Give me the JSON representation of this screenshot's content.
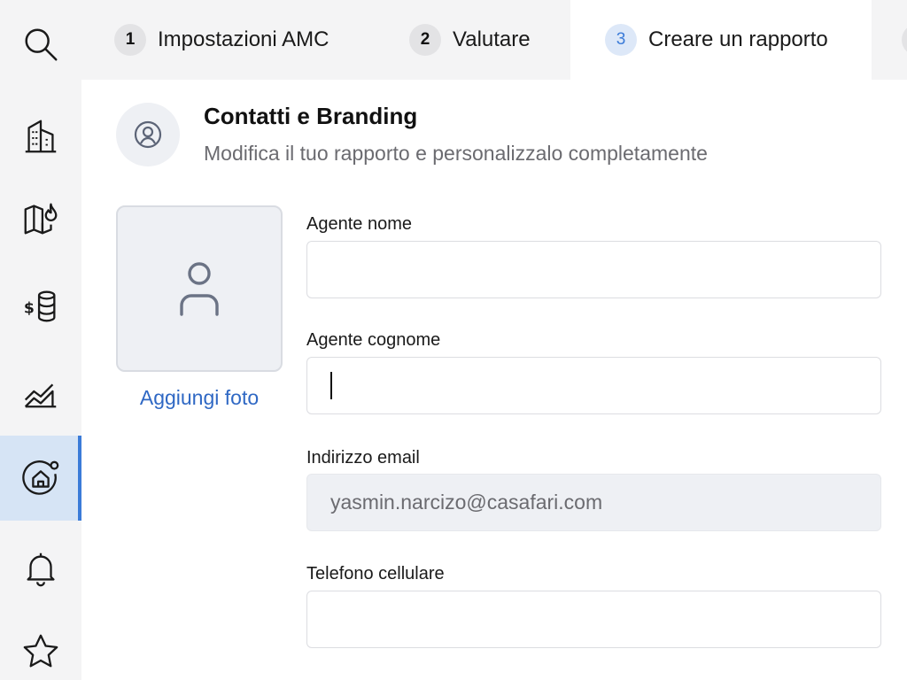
{
  "sidebar": {
    "items": [
      {
        "icon": "search-icon"
      },
      {
        "icon": "building-icon"
      },
      {
        "icon": "map-fire-icon"
      },
      {
        "icon": "dollar-database-icon"
      },
      {
        "icon": "chart-area-icon"
      },
      {
        "icon": "home-notification-icon",
        "active": true
      },
      {
        "icon": "bell-icon"
      },
      {
        "icon": "star-icon"
      }
    ],
    "accent_color": "#3b7bd8"
  },
  "tabs": [
    {
      "number": "1",
      "label": "Impostazioni AMC"
    },
    {
      "number": "2",
      "label": "Valutare"
    },
    {
      "number": "3",
      "label": "Creare un rapporto",
      "active": true
    }
  ],
  "section": {
    "title": "Contatti e Branding",
    "subtitle": "Modifica il tuo rapporto e personalizzalo completamente",
    "icon": "user-circle-icon"
  },
  "photo": {
    "icon": "user-icon",
    "link_label": "Aggiungi foto"
  },
  "form": {
    "first_name": {
      "label": "Agente nome",
      "value": ""
    },
    "last_name": {
      "label": "Agente cognome",
      "value": ""
    },
    "email": {
      "label": "Indirizzo email",
      "value": "yasmin.narcizo@casafari.com"
    },
    "phone": {
      "label": "Telefono cellulare",
      "value": ""
    }
  },
  "colors": {
    "link": "#2f68c4",
    "active_step": "#3b7bd8"
  }
}
